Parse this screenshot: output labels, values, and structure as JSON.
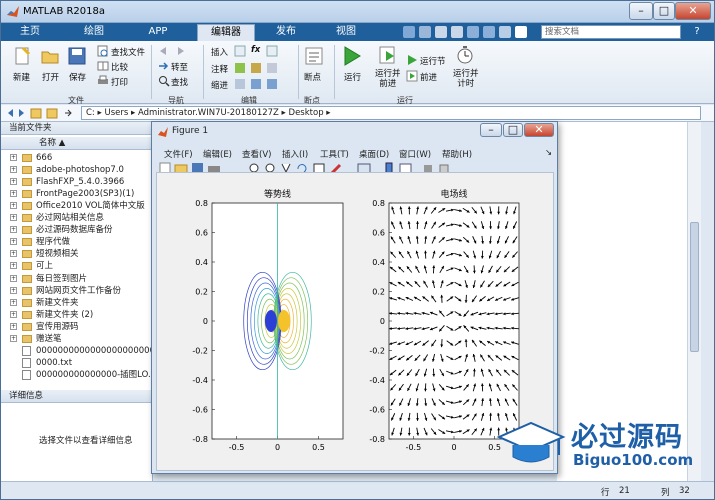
{
  "window": {
    "title": "MATLAB R2018a",
    "min": "–",
    "max": "□",
    "close": "✕"
  },
  "tabs": [
    "主页",
    "绘图",
    "APP",
    "编辑器",
    "发布",
    "视图"
  ],
  "search": {
    "placeholder": "搜索文档"
  },
  "help_glyph": "?",
  "toolstrip": {
    "new": "新建",
    "open": "打开",
    "save": "保存",
    "find_files": "查找文件",
    "compare": "比较",
    "print": "打印",
    "goto": "转至",
    "find": "查找",
    "insert": "插入",
    "comment": "注释",
    "indent": "缩进",
    "fx": "fx",
    "breakpoint": "断点",
    "run": "运行",
    "run_advance": "运行并\n前进",
    "run_section": "运行节",
    "advance": "前进",
    "run_time": "运行并\n计时",
    "groups": [
      "文件",
      "导航",
      "编辑",
      "断点",
      "运行"
    ]
  },
  "address": {
    "path": "C: ▸ Users ▸ Administrator.WIN7U-20180127Z ▸ Desktop ▸"
  },
  "current_folder": {
    "title": "当前文件夹",
    "col_name": "名称 ▲",
    "items": [
      {
        "type": "folder",
        "name": "666"
      },
      {
        "type": "folder",
        "name": "adobe-photoshop7.0"
      },
      {
        "type": "folder",
        "name": "FlashFXP_5.4.0.3966"
      },
      {
        "type": "folder",
        "name": "FrontPage2003(SP3)(1)"
      },
      {
        "type": "folder",
        "name": "Office2010 VOL简体中文版"
      },
      {
        "type": "folder",
        "name": "必过网站相关信息"
      },
      {
        "type": "folder",
        "name": "必过源码数据库备份"
      },
      {
        "type": "folder",
        "name": "程序代做"
      },
      {
        "type": "folder",
        "name": "短视频相关"
      },
      {
        "type": "folder",
        "name": "可上"
      },
      {
        "type": "folder",
        "name": "每日签到图片"
      },
      {
        "type": "folder",
        "name": "网站网页文件工作备份"
      },
      {
        "type": "folder",
        "name": "新建文件夹"
      },
      {
        "type": "folder",
        "name": "新建文件夹 (2)"
      },
      {
        "type": "folder",
        "name": "宣传用源码"
      },
      {
        "type": "folder",
        "name": "赠送笔"
      },
      {
        "type": "file",
        "name": "0000000000000000000000"
      },
      {
        "type": "file",
        "name": "0000.txt"
      },
      {
        "type": "file",
        "name": "000000000000000-插图LO..."
      }
    ]
  },
  "details": {
    "title": "详细信息",
    "message": "选择文件以查看详细信息"
  },
  "status": {
    "line_label": "行",
    "line": "21",
    "col_label": "列",
    "col": "32"
  },
  "figure": {
    "title": "Figure 1",
    "menu": [
      "文件(F)",
      "编辑(E)",
      "查看(V)",
      "插入(I)",
      "工具(T)",
      "桌面(D)",
      "窗口(W)",
      "帮助(H)"
    ],
    "menu_arrow": "↘"
  },
  "chart_data": [
    {
      "type": "contour",
      "title": "等势线",
      "xlim": [
        -0.8,
        0.8
      ],
      "ylim": [
        -0.8,
        0.8
      ],
      "xticks": [
        "-0.5",
        "0",
        "0.5"
      ],
      "yticks": [
        "0.8",
        "0.6",
        "0.4",
        "0.2",
        "0",
        "-0.2",
        "-0.4",
        "-0.6",
        "-0.8"
      ],
      "charges": [
        {
          "x": -0.1,
          "y": 0,
          "sign": "+"
        },
        {
          "x": 0.1,
          "y": 0,
          "sign": "-"
        }
      ]
    },
    {
      "type": "quiver",
      "title": "电场线",
      "xlim": [
        -0.8,
        0.8
      ],
      "ylim": [
        -0.8,
        0.8
      ],
      "xticks": [
        "-0.5",
        "0",
        "0.5"
      ],
      "yticks": [
        "0.8",
        "0.6",
        "0.4",
        "0.2",
        "0",
        "-0.2",
        "-0.4",
        "-0.6",
        "-0.8"
      ],
      "charges": [
        {
          "x": -0.1,
          "y": 0,
          "sign": "+"
        },
        {
          "x": 0.1,
          "y": 0,
          "sign": "-"
        }
      ]
    }
  ],
  "watermark": {
    "brand": "必过源码",
    "url": "Biguo100.com"
  },
  "colors": {
    "tabbar": "#1f5f9b",
    "accent": "#2a7fd0"
  }
}
